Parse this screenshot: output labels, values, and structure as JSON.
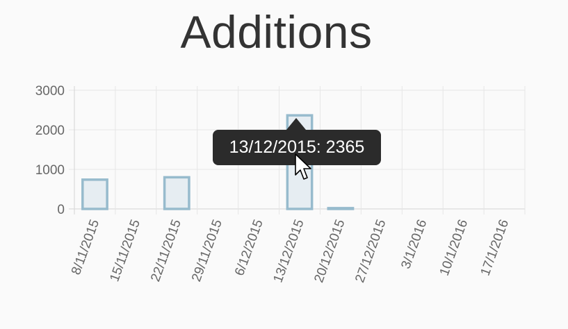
{
  "chart_data": {
    "type": "bar",
    "title": "Additions",
    "categories": [
      "8/11/2015",
      "15/11/2015",
      "22/11/2015",
      "29/11/2015",
      "6/12/2015",
      "13/12/2015",
      "20/12/2015",
      "27/12/2015",
      "3/1/2016",
      "10/1/2016",
      "17/1/2016"
    ],
    "values": [
      740,
      0,
      800,
      0,
      0,
      2365,
      20,
      0,
      0,
      0,
      0
    ],
    "ylim": [
      0,
      3000
    ],
    "yticks": [
      0,
      1000,
      2000,
      3000
    ],
    "ytick_labels": [
      "0",
      "1000",
      "2000",
      "3000"
    ],
    "grid": true,
    "colors": {
      "bar_fill": "#e6edf2",
      "bar_border": "#97bbcd",
      "grid": "#e6e6e6",
      "axis": "#d4d4d4"
    }
  },
  "tooltip": {
    "text": "13/12/2015: 2365"
  }
}
